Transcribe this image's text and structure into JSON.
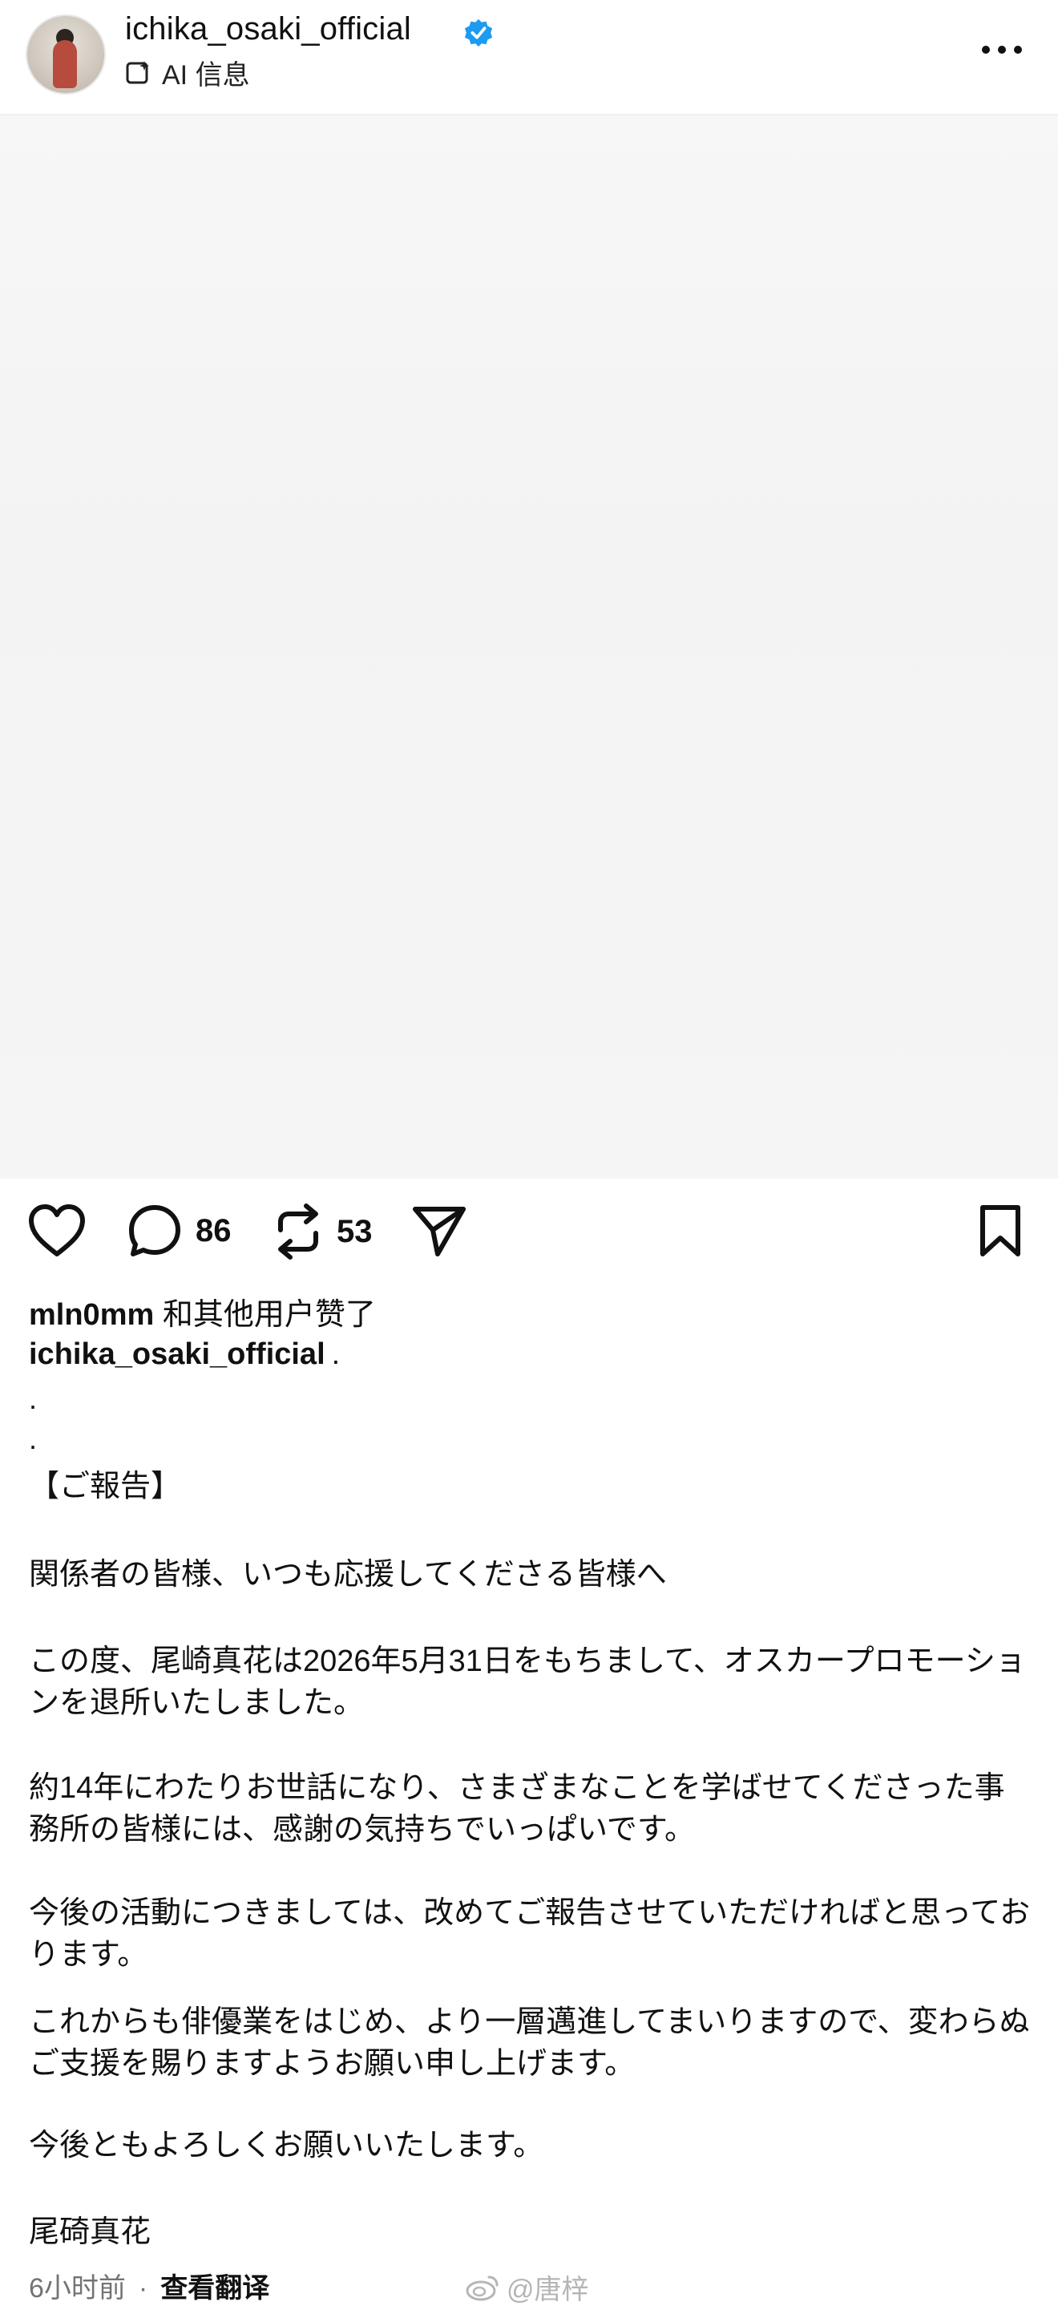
{
  "header": {
    "username": "ichika_osaki_official",
    "ai_label": "AI 信息"
  },
  "actions": {
    "comment_count": "86",
    "repost_count": "53"
  },
  "caption": {
    "liked_user": "mln0mm",
    "liked_suffix": " 和其他用户赞了",
    "author": "ichika_osaki_official",
    "author_dot": ".",
    "dot1": ".",
    "dot2": ".",
    "p1": "【ご報告】",
    "p2": "関係者の皆様、いつも応援してくださる皆様へ",
    "p3": "この度、尾崎真花は2026年5月31日をもちまして、オスカープロモーションを退所いたしました。",
    "p4": "約14年にわたりお世話になり、さまざまなことを学ばせてくださった事務所の皆様には、感謝の気持ちでいっぱいです。",
    "p5": "今後の活動につきましては、改めてご報告させていただければと思っております。",
    "p6": "これからも俳優業をはじめ、より一層邁進してまいりますので、変わらぬご支援を賜りますようお願い申し上げます。",
    "p7": "今後ともよろしくお願いいたします。",
    "p8": "尾碕真花"
  },
  "meta": {
    "time": "6小时前",
    "separator": "·",
    "translate": "查看翻译"
  },
  "watermark": {
    "text": "@唐梓"
  },
  "icons": [
    "verified-badge-icon",
    "ai-info-icon",
    "more-options-icon",
    "heart-icon",
    "comment-icon",
    "repost-icon",
    "share-icon",
    "bookmark-icon",
    "weibo-icon"
  ],
  "colors": {
    "verified": "#1d9bf0",
    "secondary_text": "#737373"
  }
}
